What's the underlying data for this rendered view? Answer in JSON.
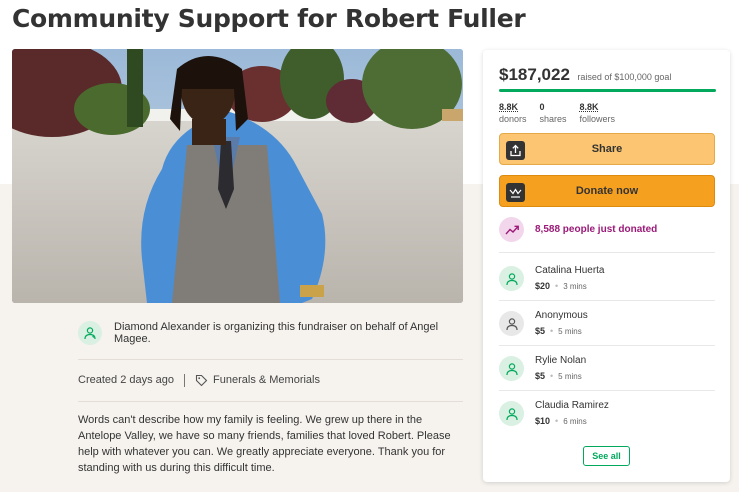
{
  "page": {
    "title": "Community Support for Robert Fuller"
  },
  "organizer": {
    "text": "Diamond Alexander is organizing this fundraiser on behalf of Angel Magee."
  },
  "meta": {
    "created": "Created 2 days ago",
    "category": "Funerals & Memorials"
  },
  "story": "Words can't describe how my family is feeling. We grew up there in the Antelope Valley, we have so many friends, families that loved Robert. Please help with whatever you can. We greatly appreciate everyone. Thank you for standing with us during this difficult time.",
  "card": {
    "amount": "$187,022",
    "goal_text": "raised of $100,000 goal",
    "progress_fraction": 1.0,
    "stats": {
      "donors_value": "8.8K",
      "donors_label": "donors",
      "shares_value": "0",
      "shares_label": "shares",
      "followers_value": "8.8K",
      "followers_label": "followers"
    },
    "share_label": "Share",
    "donate_label": "Donate now",
    "recent_text": "8,588 people just donated",
    "donations": [
      {
        "name": "Catalina Huerta",
        "amount": "$20",
        "time": "3 mins"
      },
      {
        "name": "Anonymous",
        "amount": "$5",
        "time": "5 mins"
      },
      {
        "name": "Rylie Nolan",
        "amount": "$5",
        "time": "5 mins"
      },
      {
        "name": "Claudia Ramirez",
        "amount": "$10",
        "time": "6 mins"
      }
    ],
    "see_all_label": "See all"
  },
  "colors": {
    "brand_green": "#02a95c",
    "share_button": "#fbc571",
    "donate_button": "#f6a020",
    "recent_purple": "#9b1a78"
  },
  "icons": [
    "share-icon",
    "gofundme-logo-icon",
    "trending-up-icon",
    "person-heart-icon",
    "tag-icon"
  ]
}
